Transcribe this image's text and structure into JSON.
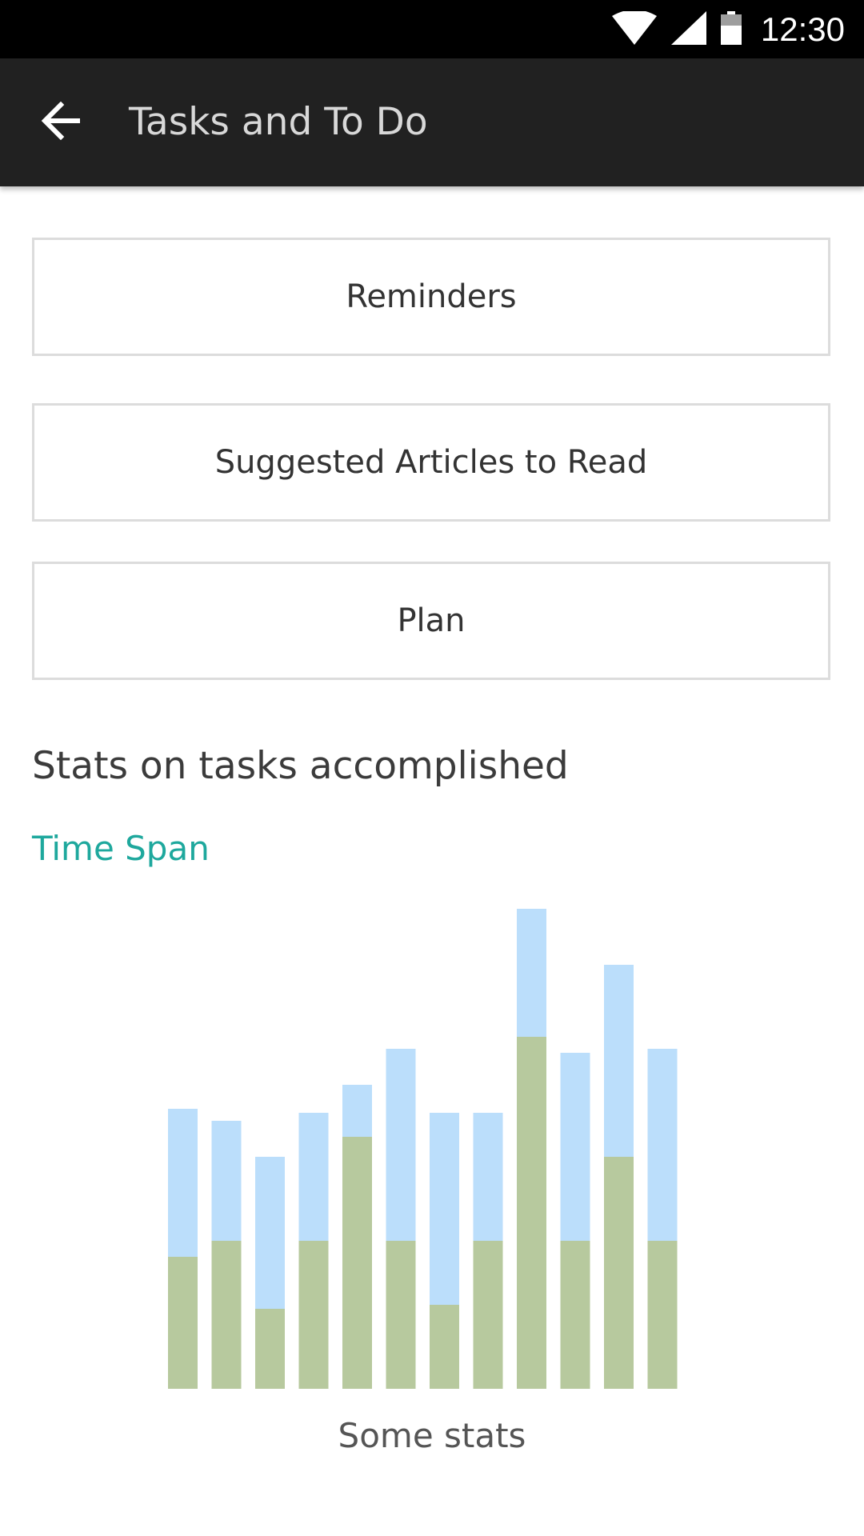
{
  "status_bar": {
    "time": "12:30",
    "icons": [
      "wifi-icon",
      "cell-signal-icon",
      "battery-icon"
    ]
  },
  "app_bar": {
    "title": "Tasks and To Do",
    "back_icon": "arrow-left-icon"
  },
  "buttons": [
    {
      "label": "Reminders"
    },
    {
      "label": "Suggested Articles to Read"
    },
    {
      "label": "Plan"
    }
  ],
  "stats": {
    "heading": "Stats on tasks accomplished",
    "time_span_label": "Time Span",
    "caption": "Some stats"
  },
  "colors": {
    "status_bar": "#000000",
    "app_bar": "#212121",
    "accent": "#1ea89d",
    "series_bottom": "#b7c99e",
    "series_top": "#bbdefb"
  },
  "chart_data": {
    "type": "bar",
    "stacked": true,
    "categories": [
      "",
      "",
      "",
      "",
      "",
      "",
      "",
      "",
      "",
      "",
      "",
      ""
    ],
    "series": [
      {
        "values": [
          33,
          37,
          20,
          37,
          63,
          37,
          21,
          37,
          88,
          37,
          58,
          37
        ]
      },
      {
        "values": [
          37,
          30,
          38,
          32,
          13,
          48,
          48,
          32,
          32,
          47,
          48,
          48
        ]
      }
    ],
    "ylim": [
      0,
      120
    ],
    "grid": false,
    "legend": "none"
  }
}
